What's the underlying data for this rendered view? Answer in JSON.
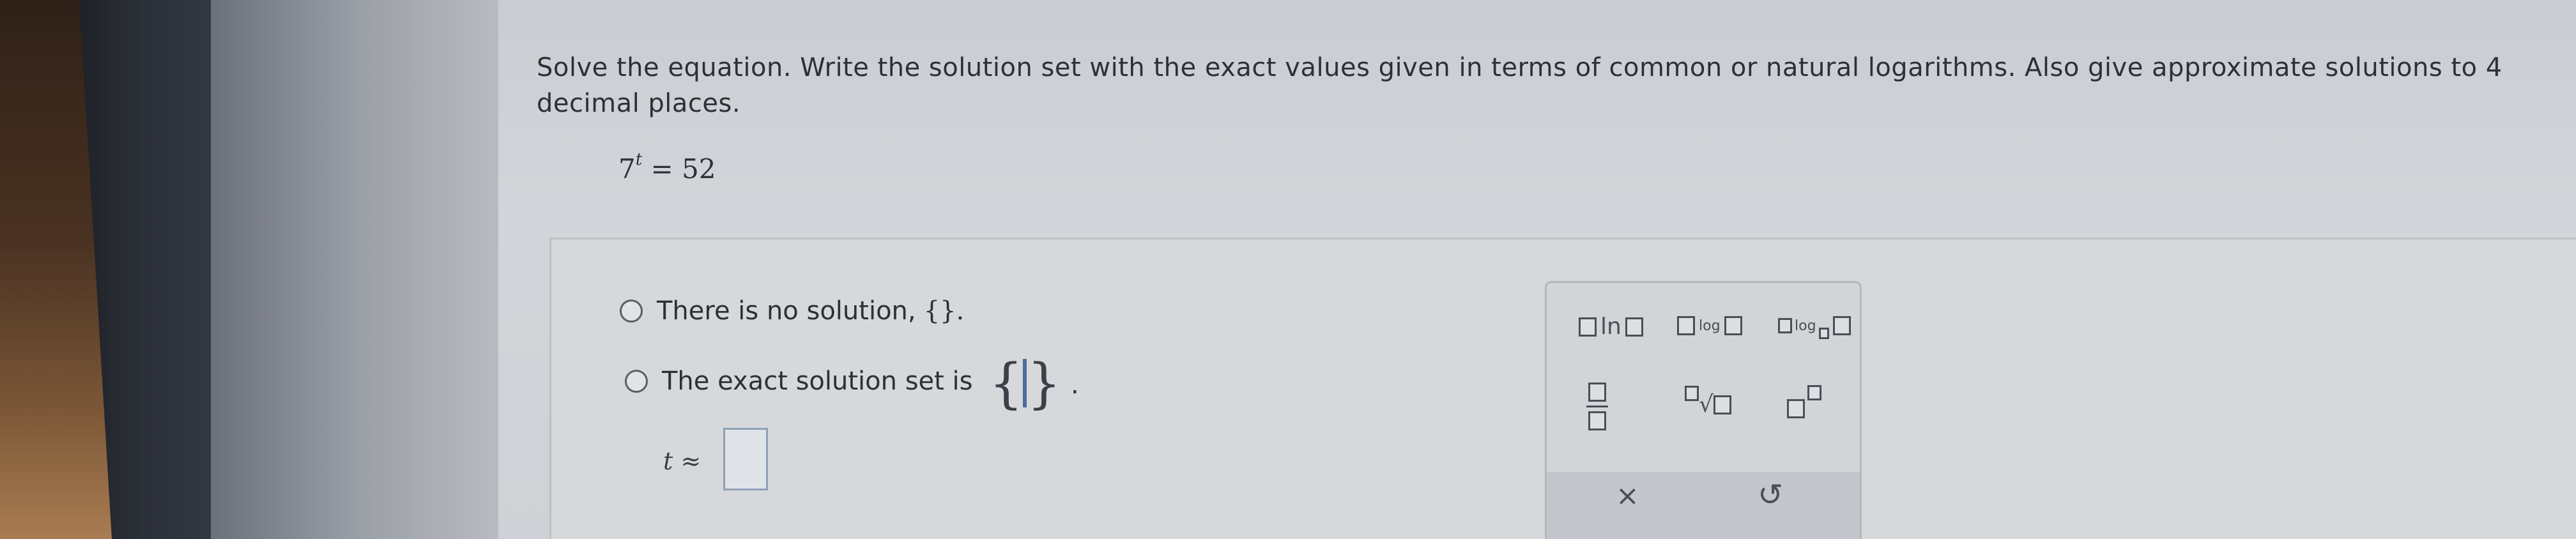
{
  "question": {
    "instruction": "Solve the equation. Write the solution set with the exact values given in terms of common or natural logarithms. Also give approximate solutions to 4 decimal places.",
    "equation_base": "7",
    "equation_exponent": "t",
    "equation_rhs": "= 52"
  },
  "options": {
    "no_solution_label": "There is no solution,",
    "no_solution_braces": "{}.",
    "exact_set_label": "The exact solution set is",
    "exact_set_period": "."
  },
  "approximation": {
    "label": "t ≈",
    "value": ""
  },
  "toolbar": {
    "ln_label": "ln",
    "log_label": "log",
    "log_base_label": "log",
    "root_symbol": "√",
    "clear_symbol": "×",
    "undo_symbol": "↺"
  },
  "colors": {
    "screen_bg": "#cfd1d6",
    "text": "#2e3036",
    "input_border": "#4a6d9c"
  }
}
